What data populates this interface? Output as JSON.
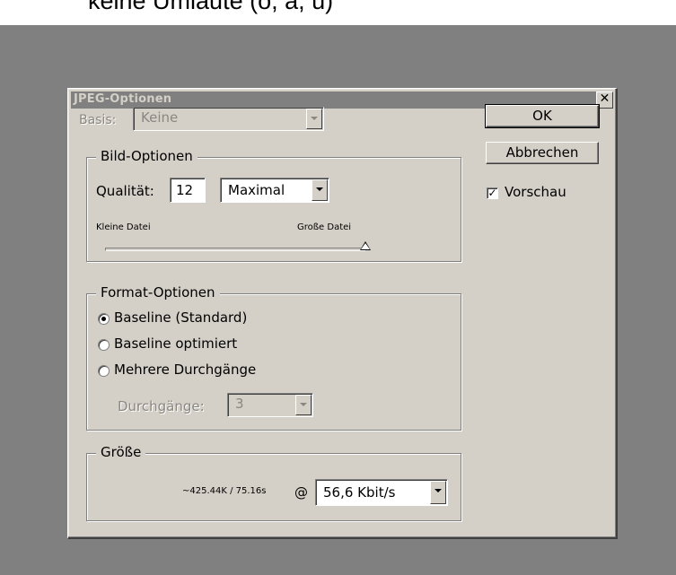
{
  "top_caption": "keine Umlaute    (ö, ä, ü)",
  "dialog": {
    "title": "JPEG-Optionen",
    "close_glyph": "✕",
    "basis": {
      "label": "Basis:",
      "value": "Keine"
    },
    "bild_optionen": {
      "legend": "Bild-Optionen",
      "quality_label": "Qualität:",
      "quality_value": "12",
      "quality_preset": "Maximal",
      "small_file_label": "Kleine Datei",
      "large_file_label": "Große Datei",
      "slider_level": 1.0
    },
    "format_optionen": {
      "legend": "Format-Optionen",
      "options": [
        "Baseline (Standard)",
        "Baseline optimiert",
        "Mehrere Durchgänge"
      ],
      "selected_index": 0,
      "passes_label": "Durchgänge:",
      "passes_value": "3"
    },
    "groesse": {
      "legend": "Größe",
      "estimate": "~425.44K / 75.16s",
      "at_symbol": "@",
      "speed": "56,6 Kbit/s"
    },
    "buttons": {
      "ok": "OK",
      "cancel": "Abbrechen"
    },
    "preview": {
      "label": "Vorschau",
      "checked": true,
      "check_glyph": "✓"
    }
  },
  "colors": {
    "dialog_bg": "#d4d0c8",
    "titlebar_bg": "#808080",
    "titlebar_text": "#d4d0c8",
    "backdrop": "#808080"
  }
}
